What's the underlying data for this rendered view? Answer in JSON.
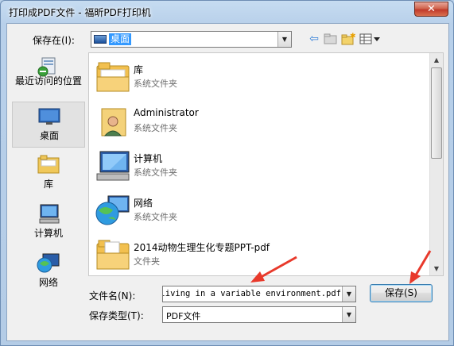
{
  "window": {
    "title": "打印成PDF文件 - 福昕PDF打印机"
  },
  "save_in": {
    "label": "保存在(I):",
    "value": "桌面"
  },
  "places": [
    {
      "label": "最近访问的位置"
    },
    {
      "label": "桌面"
    },
    {
      "label": "库"
    },
    {
      "label": "计算机"
    },
    {
      "label": "网络"
    }
  ],
  "files": [
    {
      "name": "库",
      "type": "系统文件夹",
      "icon": "library-icon"
    },
    {
      "name": "Administrator",
      "type": "系统文件夹",
      "icon": "user-folder-icon"
    },
    {
      "name": "计算机",
      "type": "系统文件夹",
      "icon": "computer-icon"
    },
    {
      "name": "网络",
      "type": "系统文件夹",
      "icon": "network-icon"
    },
    {
      "name": "2014动物生理生化专题PPT-pdf",
      "type": "文件夹",
      "icon": "folder-icon"
    }
  ],
  "file_name": {
    "label": "文件名(N):",
    "value": "a living in a variable environment.pdf"
  },
  "file_type": {
    "label": "保存类型(T):",
    "value": "PDF文件"
  },
  "buttons": {
    "save": "保存(S)"
  },
  "accent_color": "#e8392b"
}
